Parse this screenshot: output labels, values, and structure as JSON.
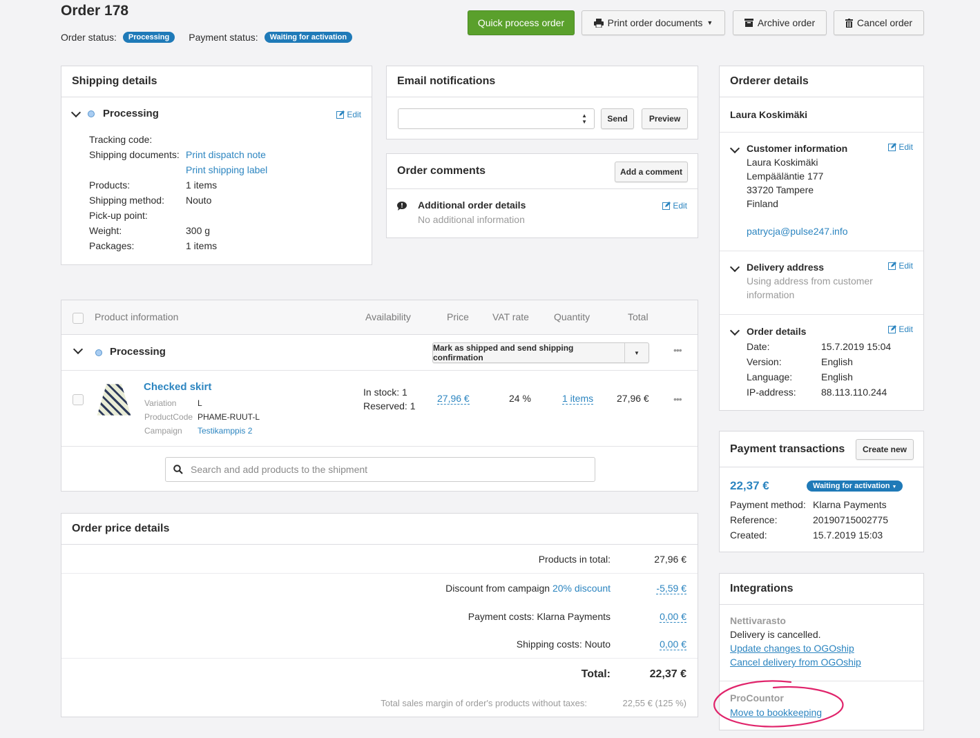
{
  "header": {
    "title": "Order 178",
    "order_status_label": "Order status:",
    "order_status": "Processing",
    "payment_status_label": "Payment status:",
    "payment_status": "Waiting for activation",
    "buttons": {
      "quick_process": "Quick process order",
      "print_docs": "Print order documents",
      "archive": "Archive order",
      "cancel": "Cancel order"
    }
  },
  "shipping": {
    "title": "Shipping details",
    "status": "Processing",
    "edit": "Edit",
    "fields": [
      {
        "label": "Tracking code:",
        "value": ""
      },
      {
        "label": "Shipping documents:",
        "links": [
          "Print dispatch note",
          "Print shipping label"
        ]
      },
      {
        "label": "Products:",
        "value": "1 items"
      },
      {
        "label": "Shipping method:",
        "value": "Nouto"
      },
      {
        "label": "Pick-up point:",
        "value": ""
      },
      {
        "label": "Weight:",
        "value": "300 g"
      },
      {
        "label": "Packages:",
        "value": "1 items"
      }
    ]
  },
  "email": {
    "title": "Email notifications",
    "select_value": "",
    "send": "Send",
    "preview": "Preview"
  },
  "comments": {
    "title": "Order comments",
    "add": "Add a comment",
    "item_title": "Additional order details",
    "item_text": "No additional information",
    "edit": "Edit"
  },
  "orderer": {
    "title": "Orderer details",
    "name": "Laura Koskimäki",
    "customer_info": {
      "title": "Customer information",
      "edit": "Edit",
      "lines": [
        "Laura Koskimäki",
        "Lempääläntie 177",
        "33720 Tampere",
        "Finland"
      ],
      "email": "patrycja@pulse247.info"
    },
    "delivery": {
      "title": "Delivery address",
      "edit": "Edit",
      "text": "Using address from customer information"
    },
    "order_details": {
      "title": "Order details",
      "edit": "Edit",
      "rows": [
        {
          "label": "Date:",
          "value": "15.7.2019 15:04"
        },
        {
          "label": "Version:",
          "value": "English"
        },
        {
          "label": "Language:",
          "value": "English"
        },
        {
          "label": "IP-address:",
          "value": "88.113.110.244"
        }
      ]
    }
  },
  "products": {
    "headers": {
      "info": "Product information",
      "availability": "Availability",
      "price": "Price",
      "vat": "VAT rate",
      "quantity": "Quantity",
      "total": "Total"
    },
    "group_status": "Processing",
    "ship_button": "Mark as shipped and send shipping confirmation",
    "item": {
      "name": "Checked skirt",
      "variation_label": "Variation",
      "variation": "L",
      "code_label": "ProductCode",
      "code": "PHAME-RUUT-L",
      "campaign_label": "Campaign",
      "campaign": "Testikamppis 2",
      "in_stock": "In stock: 1",
      "reserved": "Reserved: 1",
      "price": "27,96 €",
      "vat": "24 %",
      "quantity": "1 items",
      "total": "27,96 €"
    },
    "search_placeholder": "Search and add products to the shipment"
  },
  "price_details": {
    "title": "Order price details",
    "rows": [
      {
        "label": "Products in total:",
        "value": "27,96 €"
      },
      {
        "label": "Discount from campaign",
        "link": "20% discount",
        "value": "-5,59 €"
      },
      {
        "label": "Payment costs: Klarna Payments",
        "value": "0,00 €"
      },
      {
        "label": "Shipping costs: Nouto",
        "value": "0,00 €"
      }
    ],
    "total_label": "Total:",
    "total": "22,37 €",
    "margin_label": "Total sales margin of order's products without taxes:",
    "margin": "22,55 € (125 %)"
  },
  "payments": {
    "title": "Payment transactions",
    "create": "Create new",
    "amount": "22,37 €",
    "status": "Waiting for activation",
    "rows": [
      {
        "label": "Payment method:",
        "value": "Klarna Payments"
      },
      {
        "label": "Reference:",
        "value": "20190715002775"
      },
      {
        "label": "Created:",
        "value": "15.7.2019 15:03"
      }
    ]
  },
  "integrations": {
    "title": "Integrations",
    "nettivarasto": {
      "name": "Nettivarasto",
      "status": "Delivery is cancelled.",
      "links": [
        "Update changes to OGOship",
        "Cancel delivery from OGOship"
      ]
    },
    "procountor": {
      "name": "ProCountor",
      "link": "Move to bookkeeping"
    }
  },
  "colors": {
    "accent": "#2c85c0",
    "badge": "#1f7ab8",
    "primary_button": "#5aa02c",
    "highlight_circle": "#e0246b"
  }
}
